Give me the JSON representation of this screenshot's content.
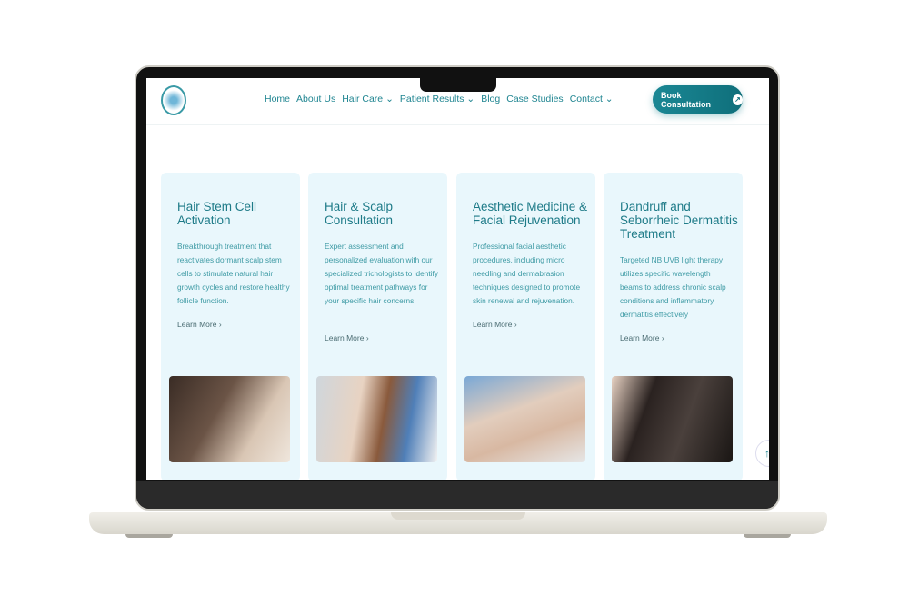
{
  "nav": {
    "items": [
      {
        "label": "Home"
      },
      {
        "label": "About Us"
      },
      {
        "label": "Hair Care ⌄"
      },
      {
        "label": "Patient Results ⌄"
      },
      {
        "label": "Blog"
      },
      {
        "label": "Case Studies"
      },
      {
        "label": "Contact ⌄"
      }
    ],
    "cta": "Book Consultation"
  },
  "cards": [
    {
      "title": "Hair Stem Cell Activation",
      "text": "Breakthrough treatment that reactivates dormant scalp stem cells to stimulate natural hair growth cycles and restore healthy follicle function.",
      "link": "Learn More ›"
    },
    {
      "title": "Hair & Scalp Consultation",
      "text": "Expert assessment and personalized evaluation with our specialized trichologists to identify optimal treatment pathways for your specific hair concerns.",
      "link": "Learn More ›"
    },
    {
      "title": "Aesthetic Medicine & Facial Rejuvenation",
      "text": "Professional facial aesthetic procedures, including micro needling and dermabrasion techniques designed to promote skin renewal and rejuvenation.",
      "link": "Learn More ›"
    },
    {
      "title": "Dandruff and Seborrheic Dermatitis Treatment",
      "text": "Targeted NB UVB light therapy utilizes specific wavelength beams to address chronic scalp conditions and inflammatory dermatitis effectively",
      "link": "Learn More ›"
    }
  ],
  "colors": {
    "accent": "#1a8794",
    "card_bg": "#e9f7fc"
  }
}
